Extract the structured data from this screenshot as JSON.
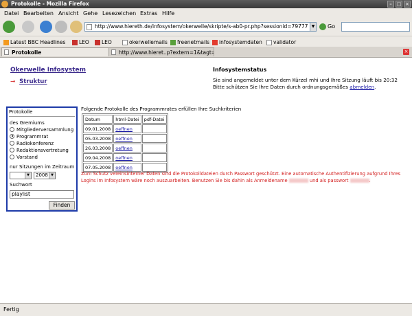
{
  "window": {
    "title": "Protokolle - Mozilla Firefox"
  },
  "menu": [
    "Datei",
    "Bearbeiten",
    "Ansicht",
    "Gehe",
    "Lesezeichen",
    "Extras",
    "Hilfe"
  ],
  "nav": {
    "url": "http://www.hiereth.de/infosystem/okerwelle/skripte/s-ab0-pr.php?sessionid=79777",
    "go_label": "Go"
  },
  "bookmarks": [
    "Latest BBC Headlines",
    "LEO",
    "LEO",
    "okerwellemails",
    "freenetmails",
    "infosystemdaten",
    "validator"
  ],
  "tabs": [
    {
      "label": "Protokolle"
    },
    {
      "label": "http://www.hieret..p?extern=1&tagt=0"
    }
  ],
  "page": {
    "site_title": "Okerwelle Infosystem",
    "nav_link": "Struktur",
    "info_heading": "Infosystemstatus",
    "info_line1": "Sie sind angemeldet unter dem Kürzel mhi und Ihre Sitzung läuft bis 20:32",
    "info_line2_pre": "Bitte schützen Sie Ihre Daten durch ordnungsgemäßes ",
    "info_logout": "abmelden",
    "info_line2_post": "."
  },
  "search": {
    "panel_title": "Protokolle",
    "gremium_label": "des Gremiums",
    "options": [
      "Mitgliederversammlung",
      "Programmrat",
      "Radiokonferenz",
      "Redaktionsvertretung",
      "Vorstand"
    ],
    "selected_option": "Programmrat",
    "period_label": "nur Sitzungen im Zeitraum",
    "month_value": "",
    "year_value": "2008",
    "keyword_label": "Suchwort",
    "keyword_value": "playlist",
    "button": "Finden"
  },
  "results": {
    "heading": "Folgende Protokolle des Programmrates erfüllen Ihre Suchkriterien",
    "columns": [
      "Datum",
      "html-Datei",
      "pdf-Datei"
    ],
    "rows": [
      {
        "date": "09.01.2008",
        "html": "oeffnen",
        "pdf": ""
      },
      {
        "date": "05.03.2008",
        "html": "oeffnen",
        "pdf": ""
      },
      {
        "date": "26.03.2008",
        "html": "oeffnen",
        "pdf": ""
      },
      {
        "date": "09.04.2008",
        "html": "oeffnen",
        "pdf": ""
      },
      {
        "date": "07.05.2008",
        "html": "oeffnen",
        "pdf": ""
      }
    ]
  },
  "warning": {
    "text1": "Zum Schutz vereinsinterner Daten sind die Protokolldateien durch Passwort geschützt. Eine automatische Authentifizierung aufgrund Ihres Logins im Infosystem wäre noch auszuarbeiten. Benutzen Sie bis dahin als Anmeldename ",
    "text2": " und als passwort ",
    "text3": "."
  },
  "status": "Fertig"
}
